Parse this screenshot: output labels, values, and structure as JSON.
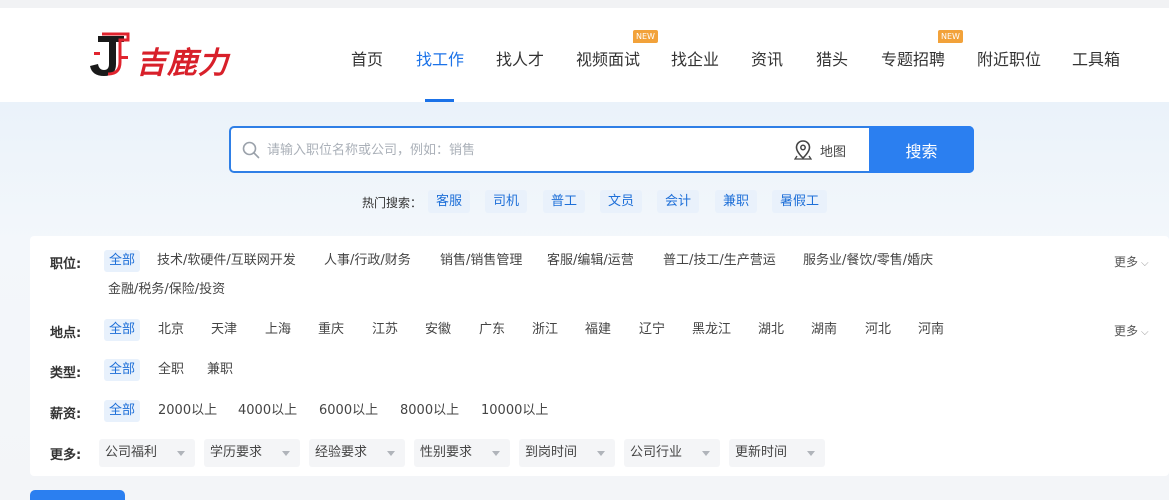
{
  "brand": {
    "name": "吉鹿力",
    "primary": "#1b72e8",
    "logo_red": "#d8202a"
  },
  "nav": {
    "items": [
      {
        "label": "首页"
      },
      {
        "label": "找工作",
        "active": true
      },
      {
        "label": "找人才"
      },
      {
        "label": "视频面试",
        "badge": "NEW"
      },
      {
        "label": "找企业"
      },
      {
        "label": "资讯"
      },
      {
        "label": "猎头"
      },
      {
        "label": "专题招聘",
        "badge": "NEW"
      },
      {
        "label": "附近职位"
      },
      {
        "label": "工具箱"
      }
    ]
  },
  "search": {
    "placeholder": "请输入职位名称或公司，例如：销售",
    "map_label": "地图",
    "button_label": "搜索",
    "hot_label": "热门搜索：",
    "hot_tags": [
      "客服",
      "司机",
      "普工",
      "文员",
      "会计",
      "兼职",
      "暑假工"
    ]
  },
  "filters": {
    "job": {
      "label": "职位:",
      "options": [
        "全部",
        "技术/软硬件/互联网开发",
        "人事/行政/财务",
        "销售/销售管理",
        "客服/编辑/运营",
        "普工/技工/生产营运",
        "服务业/餐饮/零售/婚庆"
      ],
      "options_line2": [
        "金融/税务/保险/投资"
      ],
      "more": "更多"
    },
    "location": {
      "label": "地点:",
      "options": [
        "全部",
        "北京",
        "天津",
        "上海",
        "重庆",
        "江苏",
        "安徽",
        "广东",
        "浙江",
        "福建",
        "辽宁",
        "黑龙江",
        "湖北",
        "湖南",
        "河北",
        "河南"
      ],
      "more": "更多"
    },
    "type": {
      "label": "类型:",
      "options": [
        "全部",
        "全职",
        "兼职"
      ]
    },
    "salary": {
      "label": "薪资:",
      "options": [
        "全部",
        "2000以上",
        "4000以上",
        "6000以上",
        "8000以上",
        "10000以上"
      ]
    },
    "extra": {
      "label": "更多:",
      "dropdowns": [
        "公司福利",
        "学历要求",
        "经验要求",
        "性别要求",
        "到岗时间",
        "公司行业",
        "更新时间"
      ]
    }
  }
}
